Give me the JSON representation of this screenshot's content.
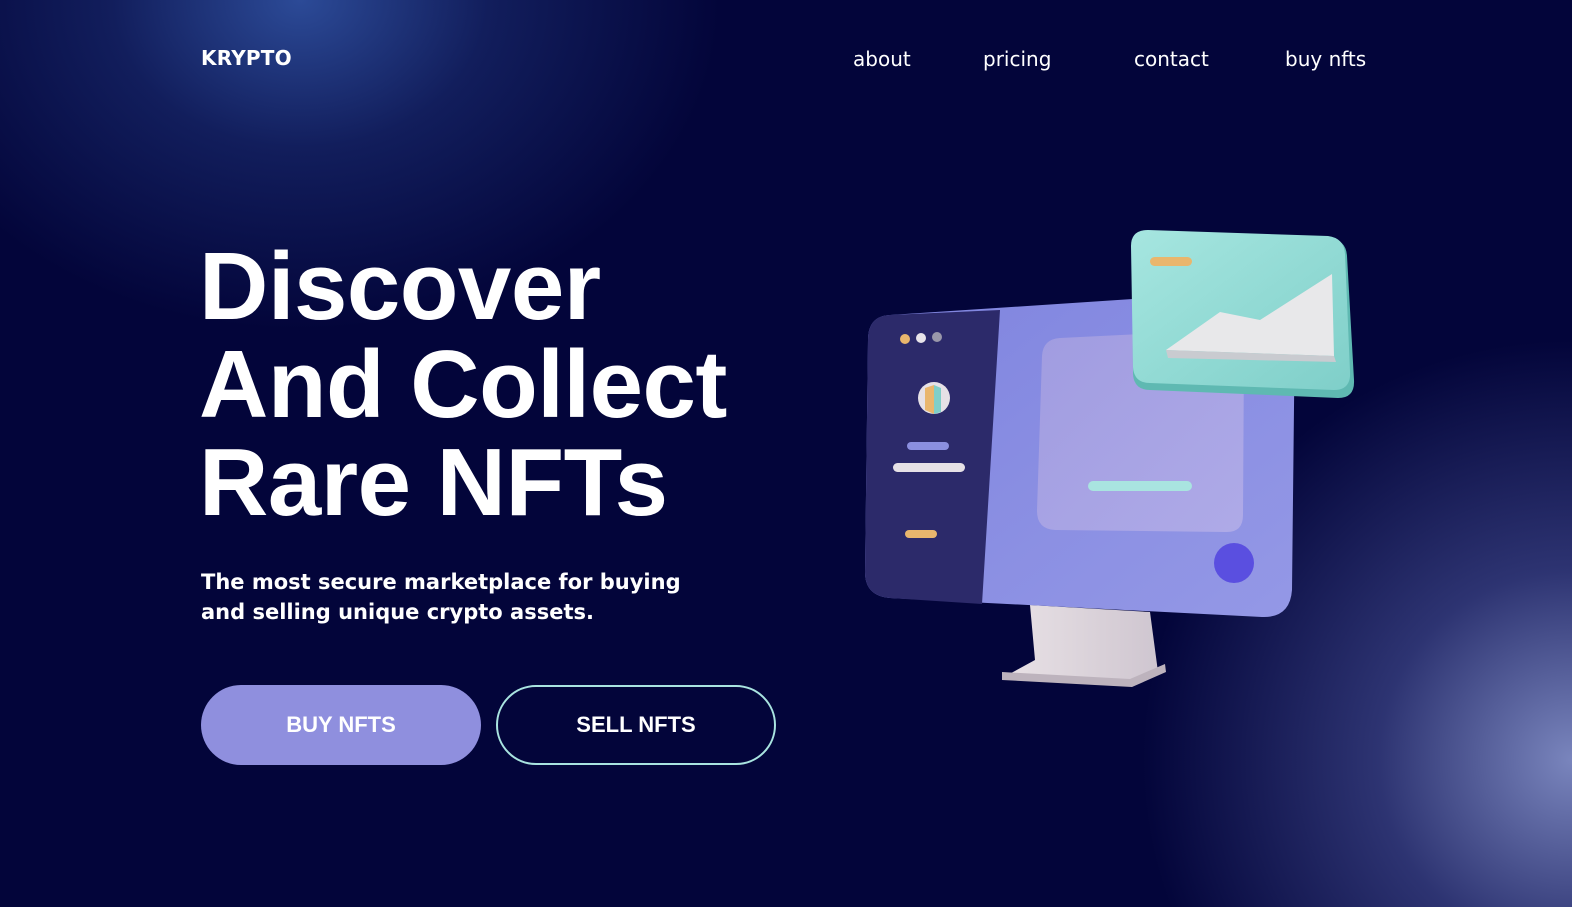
{
  "nav": {
    "logo": "KRYPTO",
    "links": [
      "about",
      "pricing",
      "contact",
      "buy nfts"
    ]
  },
  "hero": {
    "title_lines": [
      "Discover",
      "And Collect",
      "Rare NFTs"
    ],
    "subtitle": "The most secure marketplace for buying and selling unique crypto assets.",
    "buttons": {
      "buy": "BUY NFTS",
      "sell": "SELL NFTS"
    }
  },
  "illustration": {
    "name": "3d-monitor-illustration",
    "icons": [
      "monitor-icon",
      "image-card-icon"
    ]
  },
  "colors": {
    "background": "#03053a",
    "glow_top": "#2e4e9c",
    "glow_bottom": "#808cc4",
    "buy_button": "#8f8fde",
    "sell_border": "#a9e4e0",
    "monitor_screen": "#8b8fe0",
    "monitor_sidebar": "#2c2a6a",
    "image_card": "#8fd8d2"
  }
}
